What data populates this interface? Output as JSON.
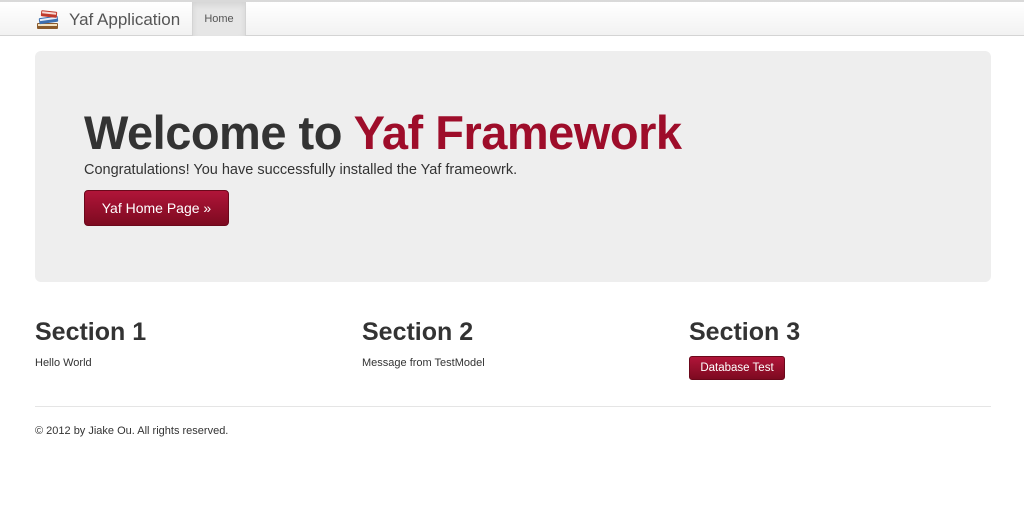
{
  "navbar": {
    "brand": "Yaf Application",
    "brand_icon": "books-icon",
    "items": [
      {
        "label": "Home",
        "active": true
      }
    ]
  },
  "hero": {
    "title_prefix": "Welcome to ",
    "title_accent": "Yaf Framework",
    "text": "Congratulations! You have successfully installed the Yaf frameowrk.",
    "button_label": "Yaf Home Page »"
  },
  "sections": [
    {
      "title": "Section 1",
      "text": "Hello World"
    },
    {
      "title": "Section 2",
      "text": "Message from TestModel"
    },
    {
      "title": "Section 3",
      "button_label": "Database Test"
    }
  ],
  "footer": {
    "text": "© 2012 by Jiake Ou. All rights reserved."
  },
  "colors": {
    "accent": "#9e0d2a",
    "hero_bg": "#eeeeee"
  }
}
